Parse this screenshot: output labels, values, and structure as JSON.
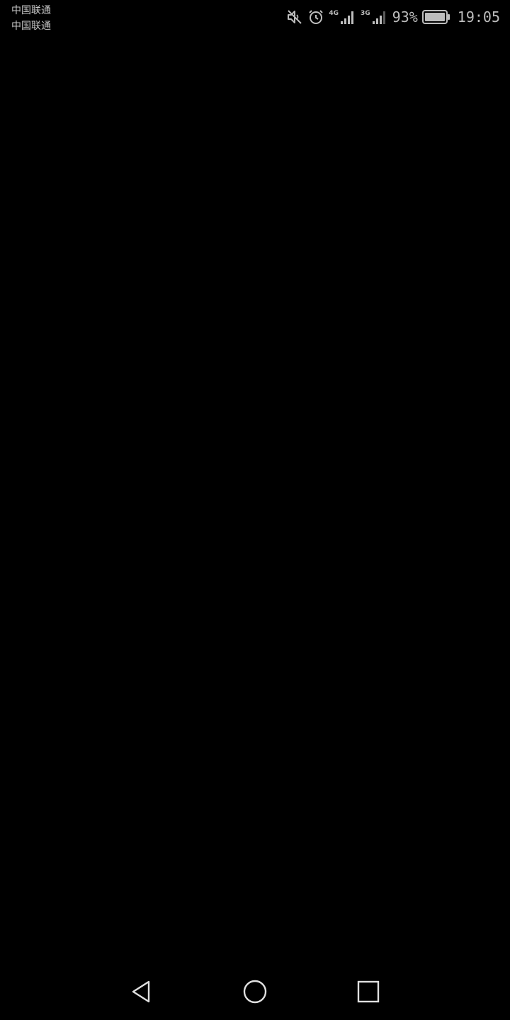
{
  "status_bar": {
    "carriers": [
      {
        "name": "中国联通"
      },
      {
        "name": "中国联通"
      }
    ],
    "icons": {
      "mute": "mute-icon",
      "alarm": "alarm-icon",
      "signal_1": "signal-icon",
      "signal_2": "signal-icon",
      "battery": "battery-icon"
    },
    "network_1": "4G",
    "network_2": "3G",
    "battery_percent": "93%",
    "time": "19:05"
  },
  "nav_bar": {
    "back": "back-icon",
    "home": "home-icon",
    "recent": "recent-apps-icon"
  }
}
